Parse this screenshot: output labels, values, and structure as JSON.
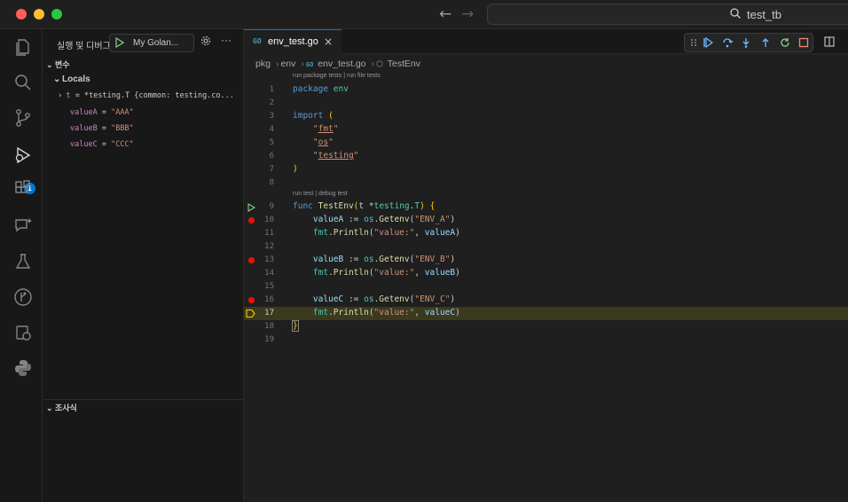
{
  "window": {
    "search_text": "test_tb"
  },
  "sidebar": {
    "run_title": "실행 및 디버그",
    "run_config": "My Golan...",
    "variables_header": "변수",
    "locals_label": "Locals",
    "variables": [
      {
        "name": "t",
        "value": "*testing.T {common: testing.co..."
      },
      {
        "name": "valueA",
        "value": "\"AAA\""
      },
      {
        "name": "valueB",
        "value": "\"BBB\""
      },
      {
        "name": "valueC",
        "value": "\"CCC\""
      }
    ],
    "watch_header": "조사식",
    "debug_badge": "1"
  },
  "editor": {
    "tab_label": "env_test.go",
    "tab_icon": "GO",
    "breadcrumb": [
      "pkg",
      "env",
      "env_test.go",
      "TestEnv"
    ],
    "codelens_package": "run package tests | run file tests",
    "codelens_func": "run test | debug test",
    "line_numbers": [
      "1",
      "2",
      "3",
      "4",
      "5",
      "6",
      "7",
      "8",
      "9",
      "10",
      "11",
      "12",
      "13",
      "14",
      "15",
      "16",
      "17",
      "18",
      "19"
    ],
    "current_line": "17",
    "breakpoint_lines": [
      "10",
      "13",
      "16"
    ]
  },
  "colors": {
    "accent": "#0078d4",
    "breakpoint": "#e51400",
    "current_line_bg": "#3b3a1f"
  }
}
